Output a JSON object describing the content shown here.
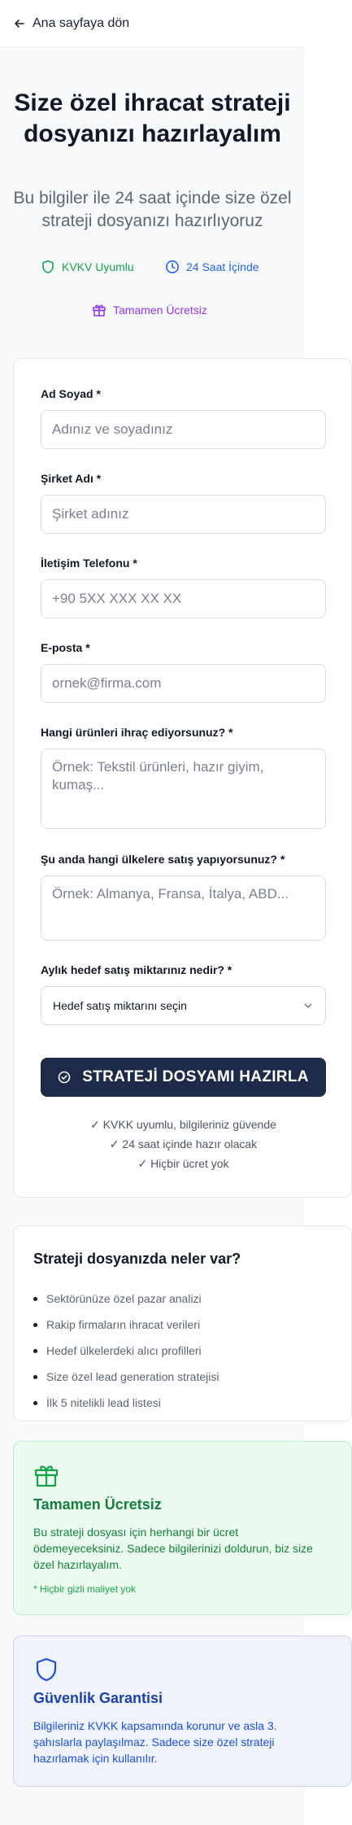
{
  "nav": {
    "back_label": "Ana sayfaya dön"
  },
  "hero": {
    "title": "Size özel ihracat strateji dosyanızı hazırlayalım",
    "subtitle": "Bu bilgiler ile 24 saat içinde size özel strateji dosyanızı hazırlıyoruz"
  },
  "badges": {
    "kvkk": "KVKV Uyumlu",
    "time": "24 Saat İçinde",
    "free": "Tamamen Ücretsiz"
  },
  "form": {
    "name_label": "Ad Soyad *",
    "name_placeholder": "Adınız ve soyadınız",
    "company_label": "Şirket Adı *",
    "company_placeholder": "Şirket adınız",
    "phone_label": "İletişim Telefonu *",
    "phone_placeholder": "+90 5XX XXX XX XX",
    "email_label": "E-posta *",
    "email_placeholder": "ornek@firma.com",
    "products_label": "Hangi ürünleri ihraç ediyorsunuz? *",
    "products_placeholder": "Örnek: Tekstil ürünleri, hazır giyim, kumaş...",
    "countries_label": "Şu anda hangi ülkelere satış yapıyorsunuz? *",
    "countries_placeholder": "Örnek: Almanya, Fransa, İtalya, ABD...",
    "target_label": "Aylık hedef satış miktarınız nedir? *",
    "target_selected": "Hedef satış miktarını seçin",
    "submit_label": "STRATEJİ DOSYAMI HAZIRLA",
    "trust_lines": [
      "✓ KVKK uyumlu, bilgileriniz güvende",
      "✓ 24 saat içinde hazır olacak",
      "✓ Hiçbir ücret yok"
    ]
  },
  "features": {
    "title": "Strateji dosyanızda neler var?",
    "items": [
      "Sektörünüze özel pazar analizi",
      "Rakip firmaların ihracat verileri",
      "Hedef ülkelerdeki alıcı profilleri",
      "Size özel lead generation stratejisi",
      "İlk 5 nitelikli lead listesi"
    ]
  },
  "free_info": {
    "title": "Tamamen Ücretsiz",
    "text": "Bu strateji dosyası için herhangi bir ücret ödemeyeceksiniz. Sadece bilgilerinizi doldurun, biz size özel hazırlayalım.",
    "note": "* Hiçbir gizli maliyet yok"
  },
  "security_info": {
    "title": "Güvenlik Garantisi",
    "text": "Bilgileriniz KVKK kapsamında korunur ve asla 3. şahıslarla paylaşılmaz. Sadece size özel strateji hazırlamak için kullanılır."
  },
  "colors": {
    "primary": "#1d2a4a",
    "green": "#16a34a",
    "blue": "#2563eb",
    "purple": "#9333ea"
  },
  "icons": [
    "arrow-left-icon",
    "shield-icon",
    "clock-icon",
    "gift-icon",
    "check-circle-icon",
    "chevron-down-icon"
  ]
}
